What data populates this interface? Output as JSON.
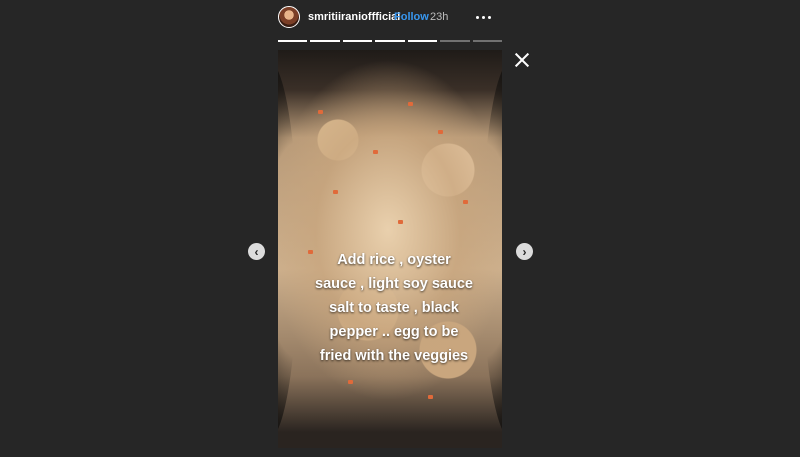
{
  "header": {
    "username": "smritiiranioffficial",
    "separator": "•",
    "follow_label": "Follow",
    "time": "23h"
  },
  "story": {
    "segments_total": 7,
    "segments_viewed": 5,
    "caption_lines": [
      "Add rice , oyster",
      "sauce , light soy sauce",
      "salt to taste , black",
      "pepper .. egg to be",
      "fried with the veggies"
    ]
  },
  "icons": {
    "close": "close-icon",
    "previous": "chevron-left-icon",
    "next": "chevron-right-icon",
    "more": "more-horizontal-icon"
  },
  "colors": {
    "background": "#262626",
    "follow": "#3897f0",
    "text": "#ffffff"
  }
}
